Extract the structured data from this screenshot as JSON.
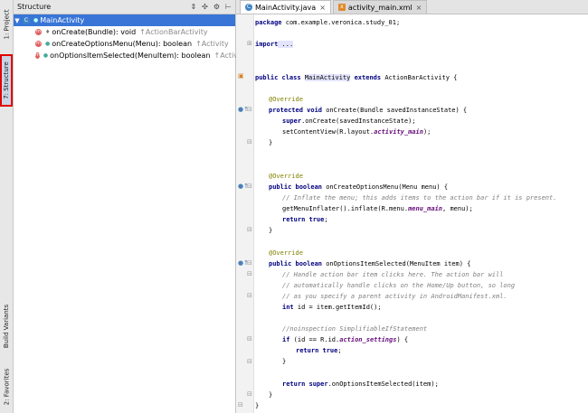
{
  "left_strip": {
    "project_tab": "1: Project",
    "structure_tab": "7: Structure",
    "build_variants_tab": "Build Variants",
    "favorites_tab": "2: Favorites"
  },
  "structure_panel": {
    "title": "Structure",
    "root": "MainActivity",
    "methods": [
      {
        "name": "onCreate(Bundle): void",
        "inherit": "↑ActionBarActivity"
      },
      {
        "name": "onCreateOptionsMenu(Menu): boolean",
        "inherit": "↑Activity"
      },
      {
        "name": "onOptionsItemSelected(MenuItem): boolean",
        "inherit": "↑Activity"
      }
    ]
  },
  "editor": {
    "tabs": [
      {
        "label": "MainActivity.java",
        "active": true
      },
      {
        "label": "activity_main.xml",
        "active": false
      }
    ],
    "code": {
      "package_kw": "package",
      "package_name": " com.example.veronica.study_01;",
      "import_kw": "import",
      "import_rest": " ...",
      "class_line": {
        "kw": "public class ",
        "name": "MainActivity",
        "ext_kw": " extends ",
        "rest": "ActionBarActivity {"
      },
      "override1": "@Override",
      "oncreate_sig": {
        "kw": "protected void ",
        "rest": "onCreate(Bundle savedInstanceState) {"
      },
      "super_oncreate": {
        "kw": "super",
        "rest": ".onCreate(savedInstanceState);"
      },
      "set_content": {
        "pre": "setContentView(R.layout.",
        "fld": "activity_main",
        "post": ");"
      },
      "brace1": "}",
      "override2": "@Override",
      "menu_sig": {
        "kw": "public boolean ",
        "rest": "onCreateOptionsMenu(Menu menu) {"
      },
      "menu_comment": "// Inflate the menu; this adds items to the action bar if it is present.",
      "inflate": {
        "pre": "getMenuInflater().inflate(R.menu.",
        "fld": "menu_main",
        "post": ", menu);"
      },
      "return_true1": {
        "kw": "return true",
        "rest": ";"
      },
      "brace2": "}",
      "override3": "@Override",
      "item_sig": {
        "kw": "public boolean ",
        "rest": "onOptionsItemSelected(MenuItem item) {"
      },
      "item_c1": "// Handle action bar item clicks here. The action bar will",
      "item_c2": "// automatically handle clicks on the Home/Up button, so long",
      "item_c3": "// as you specify a parent activity in AndroidManifest.xml.",
      "int_id": {
        "kw": "int ",
        "rest": "id = item.getItemId();"
      },
      "noinspection": "//noinspection SimplifiableIfStatement",
      "if_line": {
        "kw": "if ",
        "pre": "(id == R.id.",
        "fld": "action_settings",
        "post": ") {"
      },
      "return_true2": {
        "kw": "return true",
        "rest": ";"
      },
      "brace3": "}",
      "return_super": {
        "kw": "return super",
        "rest": ".onOptionsItemSelected(item);"
      },
      "brace4": "}",
      "brace5": "}"
    }
  }
}
